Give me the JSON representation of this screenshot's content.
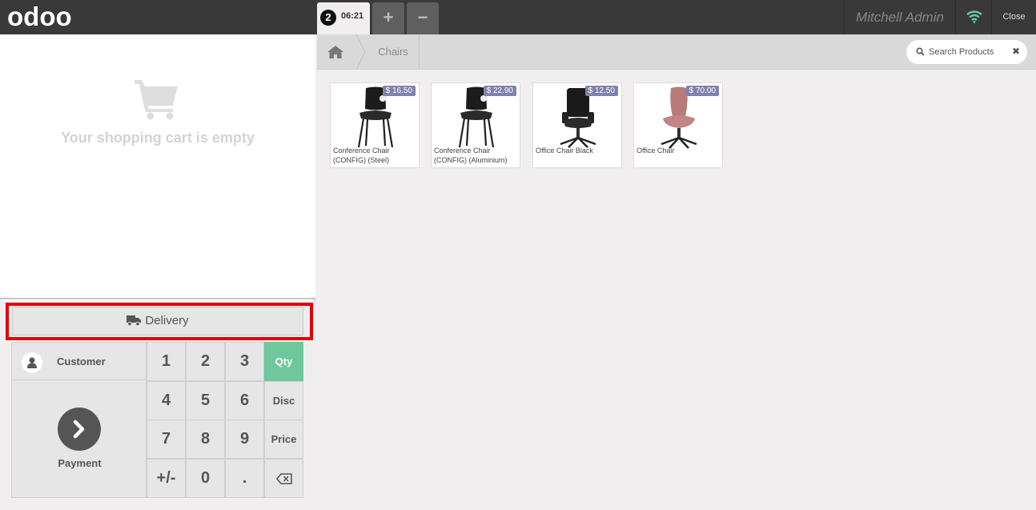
{
  "header": {
    "logo_text": "odoo",
    "order": {
      "number": "2",
      "time": "06:21"
    },
    "add_order_label": "+",
    "remove_order_label": "−",
    "user_name": "Mitchell Admin",
    "close_label": "Close",
    "wifi_color": "#6ec89b"
  },
  "cart": {
    "empty_text": "Your shopping cart is empty"
  },
  "actions": {
    "delivery_label": "Delivery",
    "customer_label": "Customer",
    "payment_label": "Payment"
  },
  "numpad": {
    "keys": [
      "1",
      "2",
      "3",
      "4",
      "5",
      "6",
      "7",
      "8",
      "9",
      "+/-",
      "0",
      "."
    ],
    "modes": [
      "Qty",
      "Disc",
      "Price"
    ],
    "active_mode": "Qty",
    "active_color": "#6ec89b"
  },
  "breadcrumb": {
    "category": "Chairs"
  },
  "search": {
    "placeholder": "Search Products",
    "clear_icon": "close-icon"
  },
  "products": [
    {
      "name": "Conference Chair (CONFIG) (Steel)",
      "price": "$ 16.50"
    },
    {
      "name": "Conference Chair (CONFIG) (Aluminium)",
      "price": "$ 22.90"
    },
    {
      "name": "Office Chair Black",
      "price": "$ 12.50"
    },
    {
      "name": "Office Chair",
      "price": "$ 70.00"
    }
  ]
}
